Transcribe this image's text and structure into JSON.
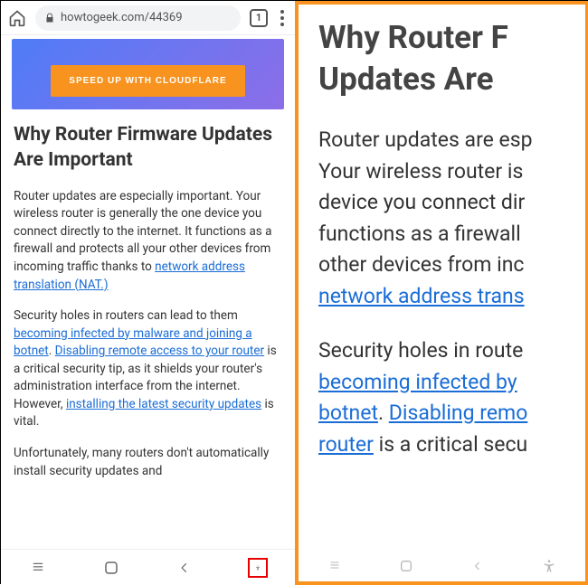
{
  "browser": {
    "url_display": "howtogeek.com/44369",
    "tab_count": "1"
  },
  "banner": {
    "cta": "SPEED UP WITH CLOUDFLARE"
  },
  "article": {
    "heading": "Why Router Firmware Updates Are Important",
    "p1_a": "Router updates are especially important. Your wireless router is generally the one device you connect directly to the internet. It functions as a firewall and protects all your other devices from incoming traffic thanks to ",
    "p1_link": "network address translation (NAT.)",
    "p2_a": "Security holes in routers can lead to them ",
    "p2_link1": "becoming infected by malware and joining a botnet",
    "p2_b": ". ",
    "p2_link2": "Disabling remote access to your router",
    "p2_c": " is a critical security tip, as it shields your router's administration interface from the internet. However, ",
    "p2_link3": "installing the latest security updates",
    "p2_d": " is vital.",
    "p3": "Unfortunately, many routers don't automatically install security updates and"
  },
  "zoomed": {
    "heading_line1": "Why Router F",
    "heading_line2": "Updates Are ",
    "p1_a": "Router updates are esp",
    "p1_b": "Your wireless router is ",
    "p1_c": "device you connect dir",
    "p1_d": "functions as a firewall ",
    "p1_e": "other devices from inc",
    "p1_link": "network address trans",
    "p2_a": "Security holes in route",
    "p2_link1": "becoming infected by ",
    "p2_link2a": "botnet",
    "p2_b": ". ",
    "p2_link2b": "Disabling remo",
    "p2_link3": "router",
    "p2_c": " is a critical secu"
  }
}
